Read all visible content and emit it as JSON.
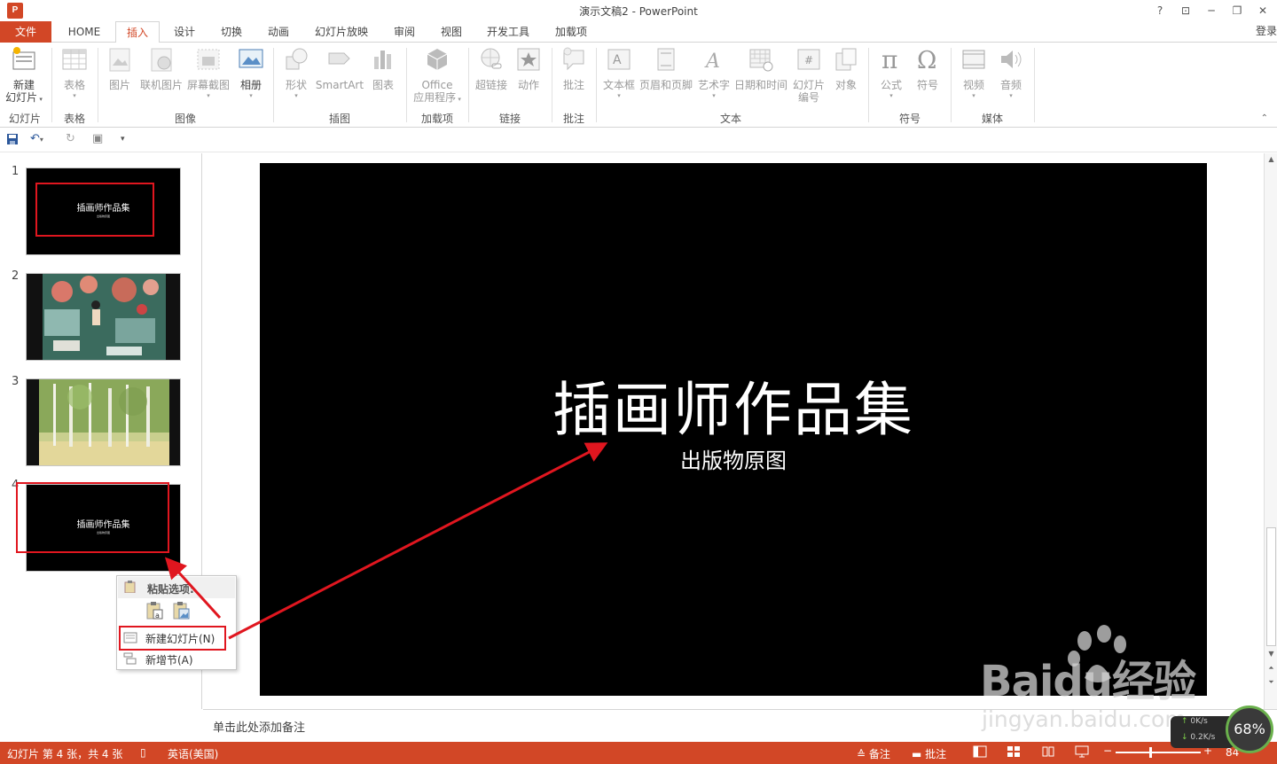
{
  "window": {
    "title": "演示文稿2 - PowerPoint",
    "logo": "P",
    "controls": [
      "?",
      "⊡",
      "─",
      "❐",
      "✕"
    ]
  },
  "tabs": [
    "文件",
    "HOME",
    "插入",
    "设计",
    "切换",
    "动画",
    "幻灯片放映",
    "审阅",
    "视图",
    "开发工具",
    "加载项"
  ],
  "active_tab": "插入",
  "login": "登录",
  "ribbon": {
    "new_slide": {
      "label1": "新建",
      "label2": "幻灯片",
      "group": "幻灯片"
    },
    "table": {
      "label": "表格",
      "group": "表格"
    },
    "images": {
      "picture": "图片",
      "online_picture": "联机图片",
      "screenshot": "屏幕截图",
      "album": "相册",
      "group": "图像"
    },
    "illustrations": {
      "shapes": "形状",
      "smartart": "SmartArt",
      "chart": "图表",
      "group": "插图"
    },
    "addins": {
      "label1": "Office",
      "label2": "应用程序",
      "group": "加载项"
    },
    "links": {
      "hyperlink": "超链接",
      "action": "动作",
      "group": "链接"
    },
    "comments": {
      "comment": "批注",
      "group": "批注"
    },
    "text": {
      "textbox": "文本框",
      "header_footer": "页眉和页脚",
      "wordart": "艺术字",
      "datetime": "日期和时间",
      "slide_num1": "幻灯片",
      "slide_num2": "编号",
      "object": "对象",
      "group": "文本"
    },
    "symbols": {
      "equation": "公式",
      "symbol": "符号",
      "group": "符号"
    },
    "media": {
      "video": "视频",
      "audio": "音频",
      "group": "媒体"
    }
  },
  "slides": [
    {
      "num": "1",
      "title": "插画师作品集",
      "type": "title"
    },
    {
      "num": "2",
      "type": "illustration"
    },
    {
      "num": "3",
      "type": "forest"
    },
    {
      "num": "4",
      "title": "插画师作品集",
      "type": "title"
    }
  ],
  "current_slide": {
    "title": "插画师作品集",
    "subtitle": "出版物原图"
  },
  "context_menu": {
    "header": "粘贴选项:",
    "items": [
      "新建幻灯片(N)",
      "新增节(A)"
    ]
  },
  "notes_placeholder": "单击此处添加备注",
  "status": {
    "slide_info": "幻灯片 第 4 张，共 4 张",
    "language": "英语(美国)",
    "notes": "备注",
    "comments": "批注",
    "zoom": "84"
  },
  "watermark": {
    "brand": "Baidu经验",
    "url": "jingyan.baidu.com"
  },
  "net_widget": {
    "up": "0K/s",
    "down": "0.2K/s",
    "percent": "68%"
  },
  "colors": {
    "accent": "#d24726",
    "highlight": "#e0161f"
  }
}
